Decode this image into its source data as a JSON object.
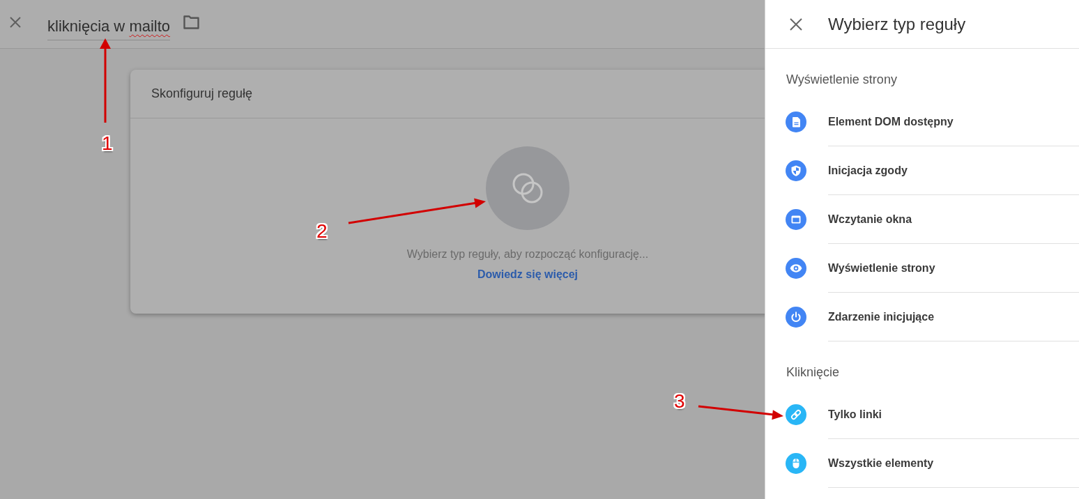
{
  "editor": {
    "title_field": {
      "segments": [
        {
          "text": "kliknięcia w ",
          "misspelled": false
        },
        {
          "text": "mailto",
          "misspelled": true
        }
      ]
    },
    "card": {
      "title": "Skonfiguruj regułę",
      "message": "Wybierz typ reguły, aby rozpocząć konfigurację...",
      "link": "Dowiedz się więcej"
    }
  },
  "panel": {
    "title": "Wybierz typ reguły",
    "sections": [
      {
        "heading": "Wyświetlenie strony",
        "items": [
          {
            "label": "Element DOM dostępny",
            "color": "#4285f4"
          },
          {
            "label": "Inicjacja zgody",
            "color": "#4285f4"
          },
          {
            "label": "Wczytanie okna",
            "color": "#4285f4"
          },
          {
            "label": "Wyświetlenie strony",
            "color": "#4285f4"
          },
          {
            "label": "Zdarzenie inicjujące",
            "color": "#4285f4"
          }
        ]
      },
      {
        "heading": "Kliknięcie",
        "items": [
          {
            "label": "Tylko linki",
            "color": "#29b6f6"
          },
          {
            "label": "Wszystkie elementy",
            "color": "#29b6f6"
          }
        ]
      }
    ]
  },
  "annotations": [
    {
      "label": "1"
    },
    {
      "label": "2"
    },
    {
      "label": "3"
    }
  ]
}
